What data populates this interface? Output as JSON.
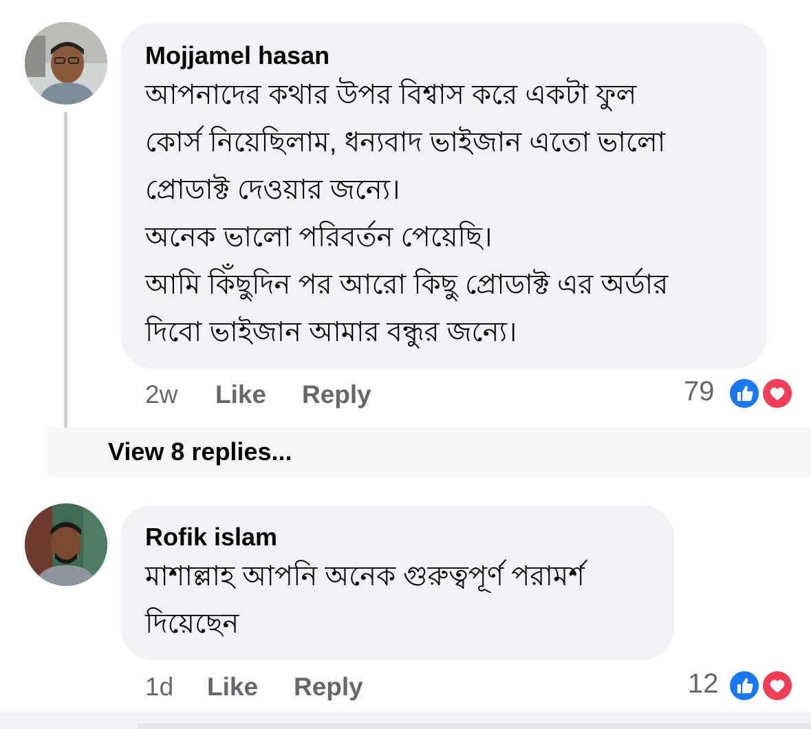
{
  "comments": [
    {
      "author": "Mojjamel hasan",
      "lines": [
        "আপনাদের কথার উপর বিশ্বাস করে একটা ফুল",
        "কোর্স নিয়েছিলাম, ধন্যবাদ ভাইজান এতো ভালো",
        "প্রোডাক্ট দেওয়ার জন্যে।",
        "অনেক ভালো পরিবর্তন পেয়েছি।",
        "আমি কিঁছুদিন পর আরো কিছু প্রোডাক্ট এর অর্ডার",
        "দিবো ভাইজান আমার বন্ধুর জন্যে।"
      ],
      "time": "2w",
      "like_label": "Like",
      "reply_label": "Reply",
      "reaction_count": "79",
      "view_replies": "View 8 replies..."
    },
    {
      "author": "Rofik islam",
      "lines": [
        "মাশাল্লাহ আপনি অনেক গুরুত্বপূর্ণ পরামর্শ",
        "দিয়েছেন"
      ],
      "time": "1d",
      "like_label": "Like",
      "reply_label": "Reply",
      "reaction_count": "12"
    }
  ],
  "icons": {
    "like": "thumbs-up-icon",
    "love": "heart-icon"
  },
  "colors": {
    "bubble": "#f0f2f5",
    "like_blue": "#1877f2",
    "love_red": "#f33e58",
    "meta_gray": "#65676b",
    "text": "#050505"
  }
}
